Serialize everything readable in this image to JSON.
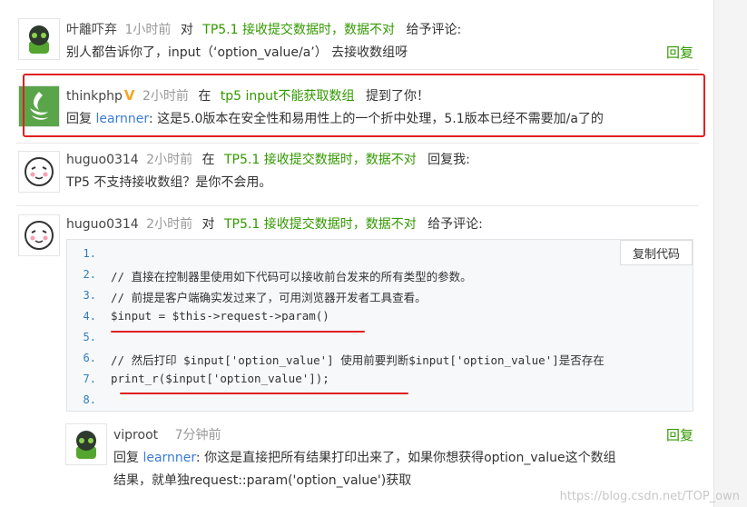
{
  "comments": [
    {
      "user": "叶離吓弃",
      "time": "1小时前",
      "verb": "对",
      "topic": "TP5.1 接收提交数据时，数据不对",
      "action": "给予评论:",
      "body": "别人都告诉你了，input（‘option_value/a’） 去接收数组呀",
      "reply_label": "回复"
    },
    {
      "user": "thinkphp",
      "badge": "V",
      "time": "2小时前",
      "verb": "在",
      "topic": "tp5 input不能获取数组",
      "action": "提到了你！",
      "body_prefix": "回复",
      "body_link": "learnner",
      "body": ": 这是5.0版本在安全性和易用性上的一个折中处理，5.1版本已经不需要加/a了的"
    },
    {
      "user": "huguo0314",
      "time": "2小时前",
      "verb": "在",
      "topic": "TP5.1 接收提交数据时，数据不对",
      "action": "回复我:",
      "body": "TP5 不支持接收数组？是你不会用。"
    },
    {
      "user": "huguo0314",
      "time": "2小时前",
      "verb": "对",
      "topic": "TP5.1 接收提交数据时，数据不对",
      "action": "给予评论:"
    },
    {
      "user": "viproot",
      "time": "7分钟前",
      "body_prefix": "回复",
      "body_link": "learnner",
      "body_line1": ": 你这是直接把所有结果打印出来了，如果你想获得option_value这个数组",
      "body_line2": "结果，就单独request::param('option_value')获取",
      "reply_label": "回复"
    }
  ],
  "code": {
    "copy_label": "复制代码",
    "line_numbers": [
      "1.",
      "2.",
      "3.",
      "4.",
      "5.",
      "6.",
      "7.",
      "8."
    ],
    "lines": [
      "",
      "// 直接在控制器里使用如下代码可以接收前台发来的所有类型的参数。",
      "// 前提是客户端确实发过来了，可用浏览器开发者工具查看。",
      "$input = $this->request->param()",
      "",
      "// 然后打印 $input['option_value'] 使用前要判断$input['option_value']是否存在",
      "print_r($input['option_value']);",
      ""
    ]
  },
  "watermark": "https://blog.csdn.net/TOP_own",
  "colors": {
    "topic": "#339900",
    "link": "#3a7bd5",
    "highlight_box": "#e02020"
  }
}
